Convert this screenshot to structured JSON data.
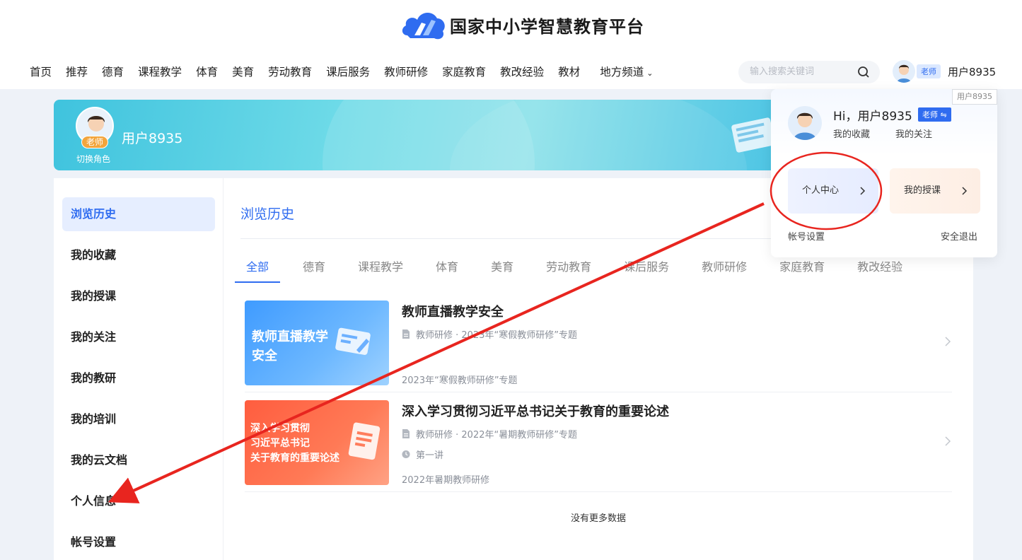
{
  "site": {
    "name": "国家中小学智慧教育平台"
  },
  "nav": {
    "items": [
      "首页",
      "推荐",
      "德育",
      "课程教学",
      "体育",
      "美育",
      "劳动教育",
      "课后服务",
      "教师研修",
      "家庭教育",
      "教改经验",
      "教材"
    ],
    "regional": "地方频道"
  },
  "search": {
    "placeholder": "输入搜索关键词"
  },
  "user": {
    "role": "老师",
    "name": "用户8935"
  },
  "banner": {
    "role": "老师",
    "switch": "切换角色",
    "name": "用户8935"
  },
  "sidebar": {
    "items": [
      "浏览历史",
      "我的收藏",
      "我的授课",
      "我的关注",
      "我的教研",
      "我的培训",
      "我的云文档",
      "个人信息",
      "帐号设置"
    ],
    "active_index": 0
  },
  "main": {
    "title": "浏览历史",
    "tabs": [
      "全部",
      "德育",
      "课程教学",
      "体育",
      "美育",
      "劳动教育",
      "课后服务",
      "教师研修",
      "家庭教育",
      "教改经验"
    ],
    "active_tab": 0,
    "cards": [
      {
        "thumb_text": "教师直播教学\n安全",
        "title": "教师直播教学安全",
        "meta": "教师研修 · 2023年“寒假教师研修”专题",
        "footer": "2023年“寒假教师研修”专题"
      },
      {
        "thumb_text": "深入学习贯彻\n习近平总书记\n关于教育的重要论述",
        "title": "深入学习贯彻习近平总书记关于教育的重要论述",
        "meta": "教师研修 · 2022年“暑期教师研修”专题",
        "lecture": "第一讲",
        "footer": "2022年暑期教师研修"
      }
    ],
    "no_more": "没有更多数据"
  },
  "popup": {
    "tooltip": "用户8935",
    "hi": "Hi，用户8935",
    "role": "老师 ⇋",
    "links": [
      "我的收藏",
      "我的关注"
    ],
    "quick": [
      "个人中心",
      "我的授课"
    ],
    "account": "帐号设置",
    "logout": "安全退出"
  },
  "colors": {
    "accent": "#2f6cf0",
    "annotation": "#e8251f"
  }
}
